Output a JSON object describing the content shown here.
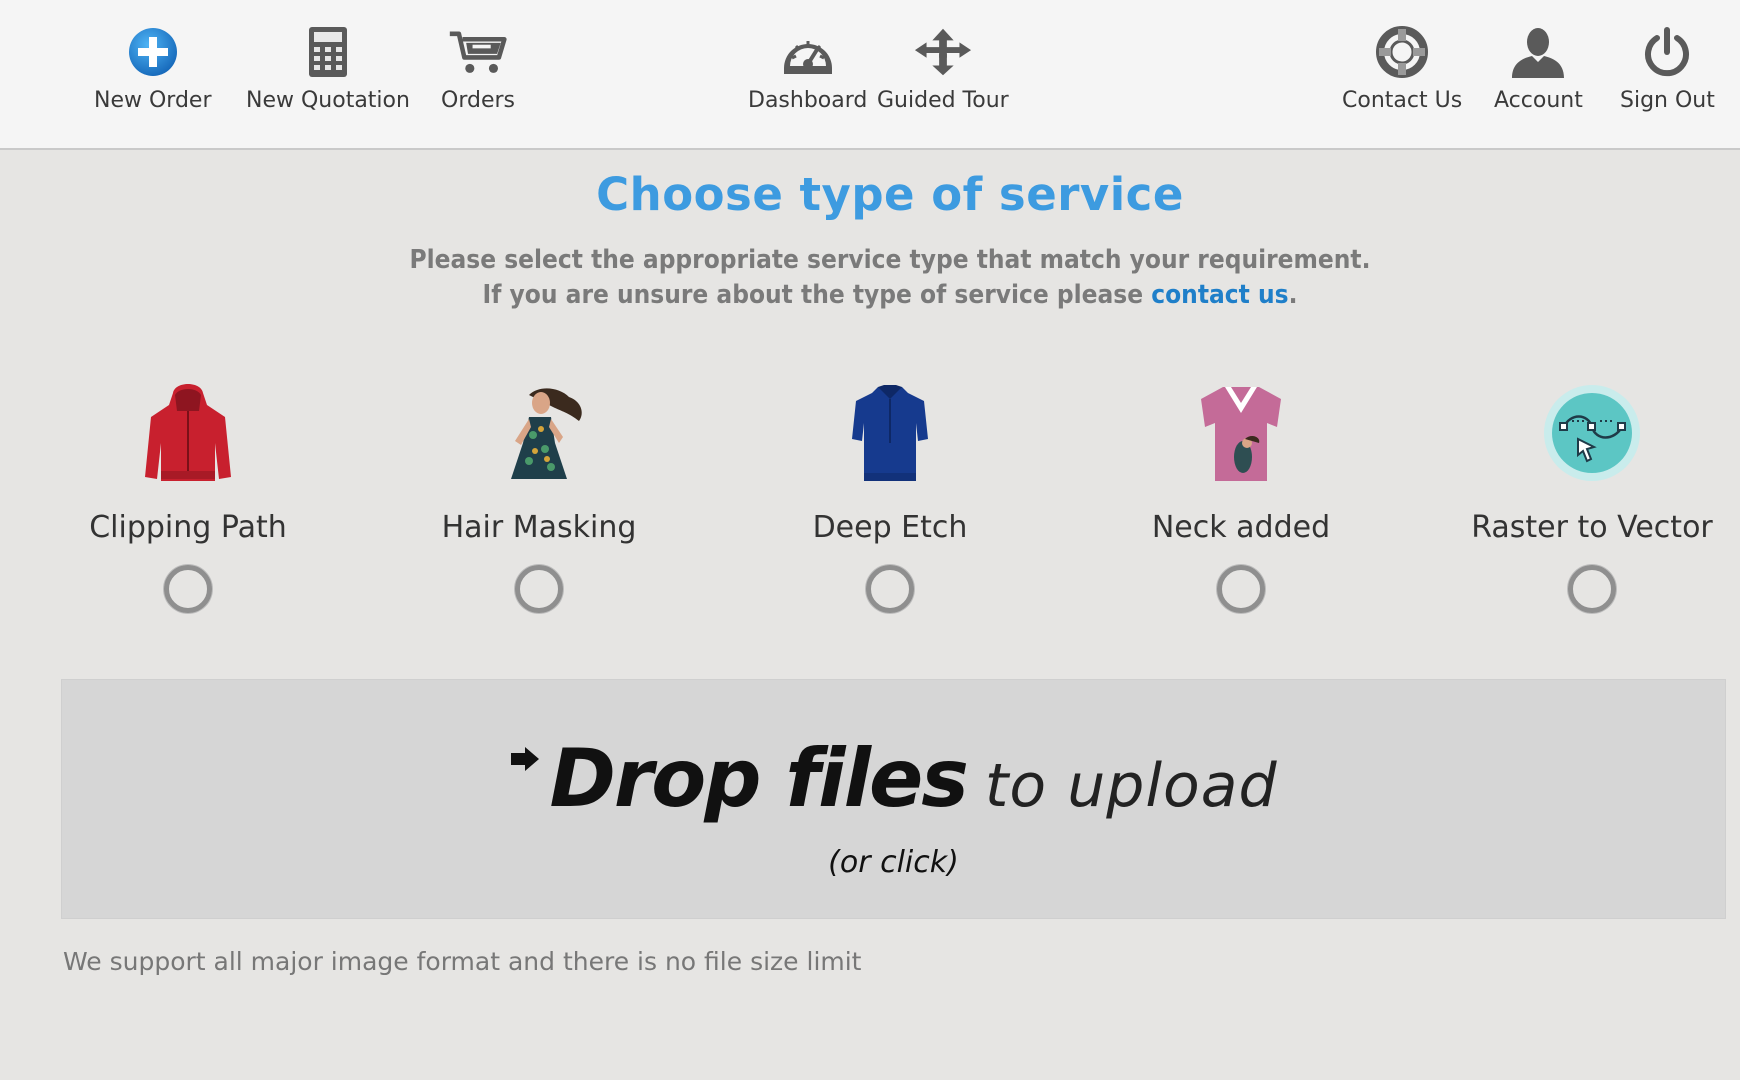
{
  "nav": {
    "new_order": "New Order",
    "new_quotation": "New Quotation",
    "orders": "Orders",
    "dashboard": "Dashboard",
    "guided_tour": "Guided Tour",
    "contact_us": "Contact Us",
    "account": "Account",
    "sign_out": "Sign Out"
  },
  "heading": {
    "title": "Choose type of service",
    "line1": "Please select the appropriate service type that match your requirement.",
    "line2_prefix": "If you are unsure about the type of service please ",
    "line2_link": "contact us",
    "line2_suffix": "."
  },
  "services": [
    {
      "label": "Clipping Path",
      "selected": false
    },
    {
      "label": "Hair Masking",
      "selected": false
    },
    {
      "label": "Deep Etch",
      "selected": false
    },
    {
      "label": "Neck added",
      "selected": false
    },
    {
      "label": "Raster to Vector",
      "selected": false
    }
  ],
  "dropzone": {
    "bold": "Drop files",
    "light": "to upload",
    "sub": "(or click)"
  },
  "support_note": "We support all major image format and there is no file size limit",
  "colors": {
    "accent": "#3d9be0",
    "link": "#1f7fc9",
    "background": "#e6e5e3",
    "topbar": "#f5f5f5",
    "dropzone": "#d6d6d6"
  }
}
